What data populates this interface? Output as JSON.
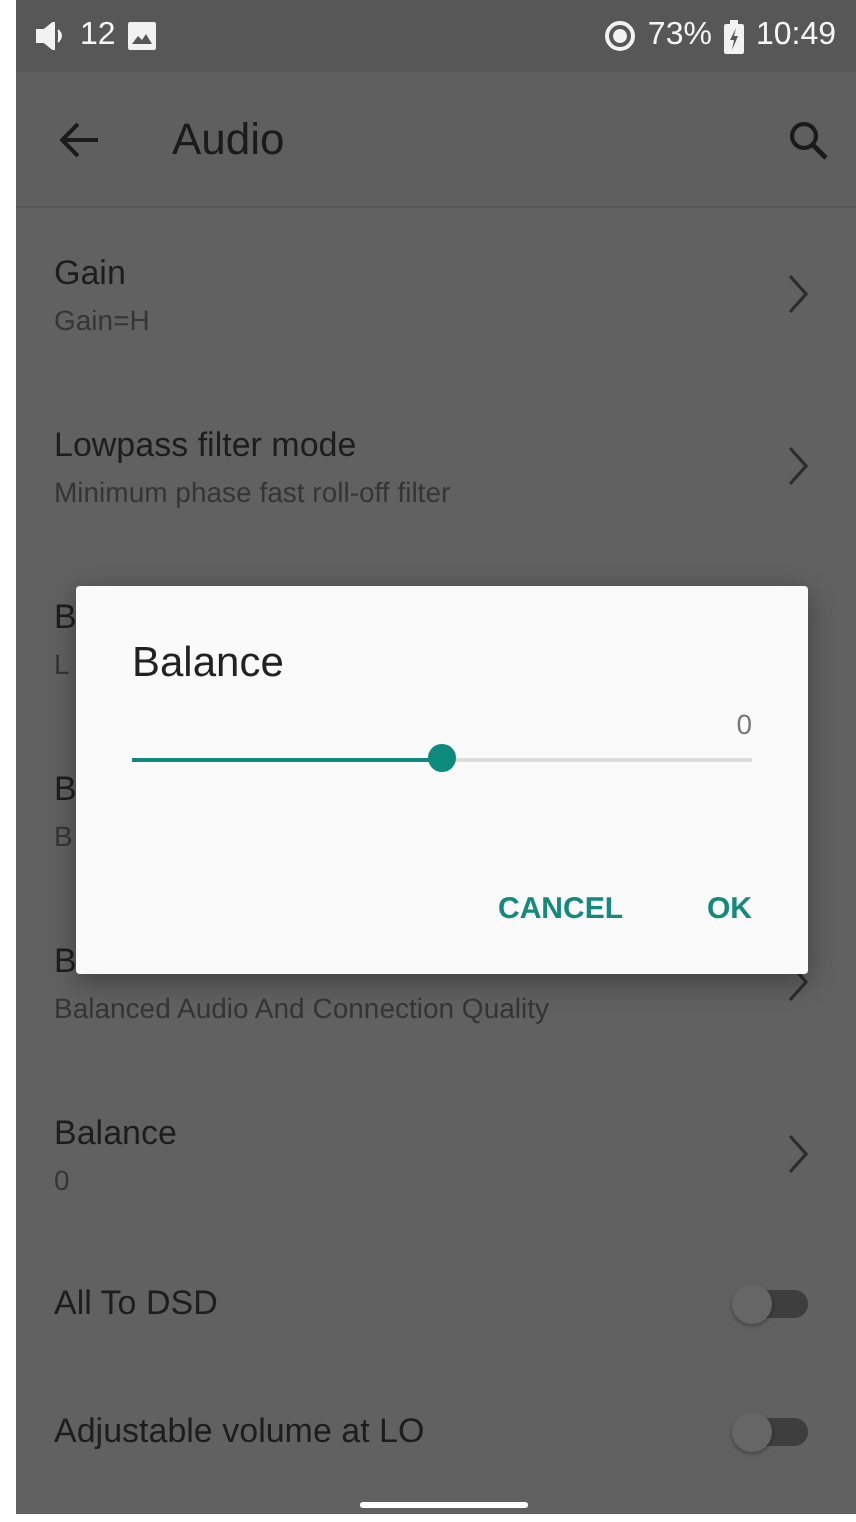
{
  "status_bar": {
    "volume": "12",
    "battery": "73%",
    "time": "10:49"
  },
  "toolbar": {
    "title": "Audio"
  },
  "settings": [
    {
      "kind": "link",
      "title": "Gain",
      "subtitle": "Gain=H"
    },
    {
      "kind": "link",
      "title": "Lowpass filter mode",
      "subtitle": "Minimum phase fast roll-off filter"
    },
    {
      "kind": "link",
      "title": "B",
      "subtitle": "L"
    },
    {
      "kind": "link",
      "title": "B",
      "subtitle": "B"
    },
    {
      "kind": "link",
      "title": "B",
      "subtitle": "Balanced Audio And Connection Quality"
    },
    {
      "kind": "link",
      "title": "Balance",
      "subtitle": "0"
    },
    {
      "kind": "switch",
      "title": "All To DSD",
      "on": false
    },
    {
      "kind": "switch",
      "title": "Adjustable volume at LO",
      "on": false
    }
  ],
  "dialog": {
    "title": "Balance",
    "value": "0",
    "level": 0.5,
    "buttons": [
      "CANCEL",
      "OK"
    ]
  }
}
